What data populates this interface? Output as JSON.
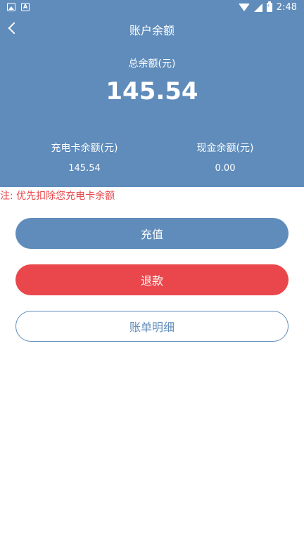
{
  "status_bar": {
    "time": "2:48",
    "left_icons": [
      "image-icon",
      "a-icon"
    ],
    "right_icons": [
      "wifi-icon",
      "signal-icon",
      "battery-icon"
    ]
  },
  "nav": {
    "title": "账户余额",
    "back_icon": "chevron-left-icon"
  },
  "balance": {
    "total_label": "总余额(元)",
    "total_amount": "145.54",
    "card_label": "充电卡余额(元)",
    "card_amount": "145.54",
    "cash_label": "现金余额(元)",
    "cash_amount": "0.00"
  },
  "notice": "注: 优先扣除您充电卡余额",
  "buttons": {
    "recharge": "充值",
    "refund": "退款",
    "detail": "账单明细"
  },
  "colors": {
    "primary": "#5f8cbb",
    "danger": "#e9474c",
    "notice_text": "#e8474b"
  }
}
